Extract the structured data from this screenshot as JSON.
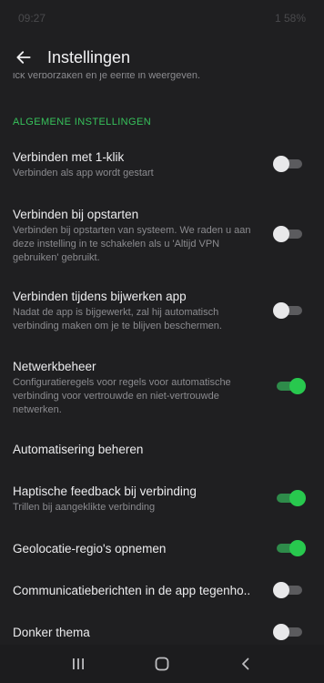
{
  "statusbar": {
    "time": "09:27",
    "right": "1 58%"
  },
  "appbar": {
    "title": "Instellingen"
  },
  "cutoff_text": "ick verborzaken en je eerlte in weergeven.",
  "section": {
    "title": "ALGEMENE INSTELLINGEN"
  },
  "settings": [
    {
      "title": "Verbinden met 1-klik",
      "subtitle": "Verbinden als app wordt gestart",
      "on": false
    },
    {
      "title": "Verbinden bij opstarten",
      "subtitle": "Verbinden bij opstarten van systeem. We raden u aan deze instelling in te schakelen als u 'Altijd VPN gebruiken' gebruikt.",
      "on": false
    },
    {
      "title": "Verbinden tijdens bijwerken app",
      "subtitle": "Nadat de app is bijgewerkt, zal hij automatisch verbinding maken om je te blijven beschermen.",
      "on": false
    },
    {
      "title": "Netwerkbeheer",
      "subtitle": "Configuratieregels voor regels voor automatische verbinding voor vertrouwde en niet-vertrouwde netwerken.",
      "on": true
    },
    {
      "title": "Automatisering beheren"
    },
    {
      "title": "Haptische feedback bij verbinding",
      "subtitle": "Trillen bij aangeklikte verbinding",
      "on": true
    },
    {
      "title": "Geolocatie-regio's opnemen",
      "on": true
    },
    {
      "title": "Communicatieberichten in de app tegenho..",
      "on": false
    },
    {
      "title": "Donker thema",
      "on": false
    }
  ],
  "colors": {
    "accent": "#37c15b",
    "background": "#1f1f21"
  },
  "icons": {
    "back": "arrow-left-icon",
    "recents": "recents-icon",
    "home": "home-icon",
    "nav_back": "chevron-left-icon"
  }
}
